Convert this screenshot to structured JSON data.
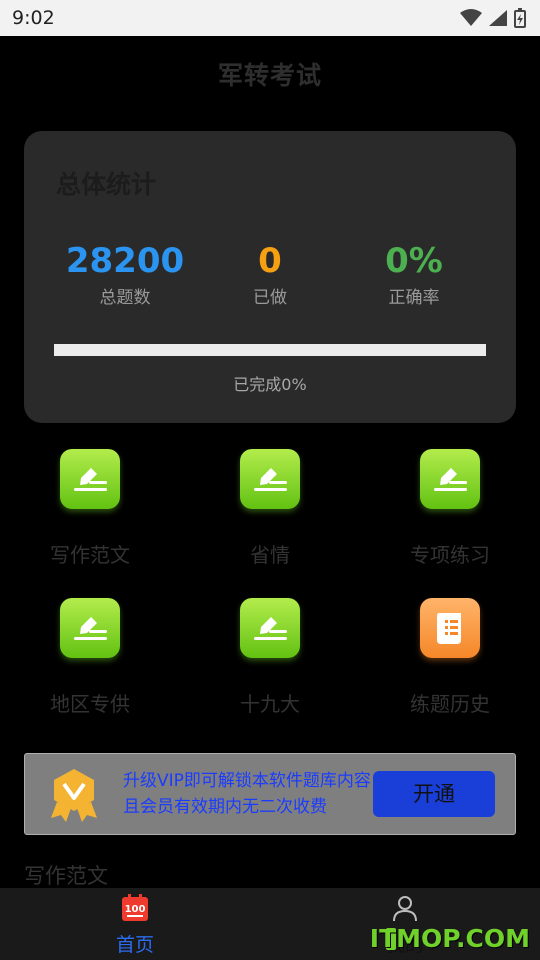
{
  "status_bar": {
    "time": "9:02"
  },
  "app": {
    "title": "军转考试"
  },
  "stats": {
    "title": "总体统计",
    "items": [
      {
        "value": "28200",
        "label": "总题数",
        "color": "#2b94f0"
      },
      {
        "value": "0",
        "label": "已做",
        "color": "#f5a012"
      },
      {
        "value": "0%",
        "label": "正确率",
        "color": "#4caf50"
      }
    ],
    "progress_fraction": 0,
    "progress_text": "已完成0%"
  },
  "grid": {
    "items": [
      {
        "label": "写作范文",
        "icon": "pencil-icon"
      },
      {
        "label": "省情",
        "icon": "pencil-icon"
      },
      {
        "label": "专项练习",
        "icon": "pencil-icon"
      },
      {
        "label": "地区专供",
        "icon": "pencil-icon"
      },
      {
        "label": "十九大",
        "icon": "pencil-icon"
      },
      {
        "label": "练题历史",
        "icon": "scroll-icon"
      }
    ]
  },
  "vip": {
    "line1": "升级VIP即可解锁本软件题库内容",
    "line2": "且会员有效期内无二次收费",
    "button": "开通"
  },
  "section": {
    "title": "写作范文"
  },
  "nav": {
    "items": [
      {
        "label": "首页",
        "icon": "exam-100-icon",
        "active": true
      },
      {
        "label": "我的",
        "icon": "person-icon",
        "active": false
      }
    ],
    "active_color": "#2b6cf0"
  },
  "watermark": "ITMOP.COM"
}
